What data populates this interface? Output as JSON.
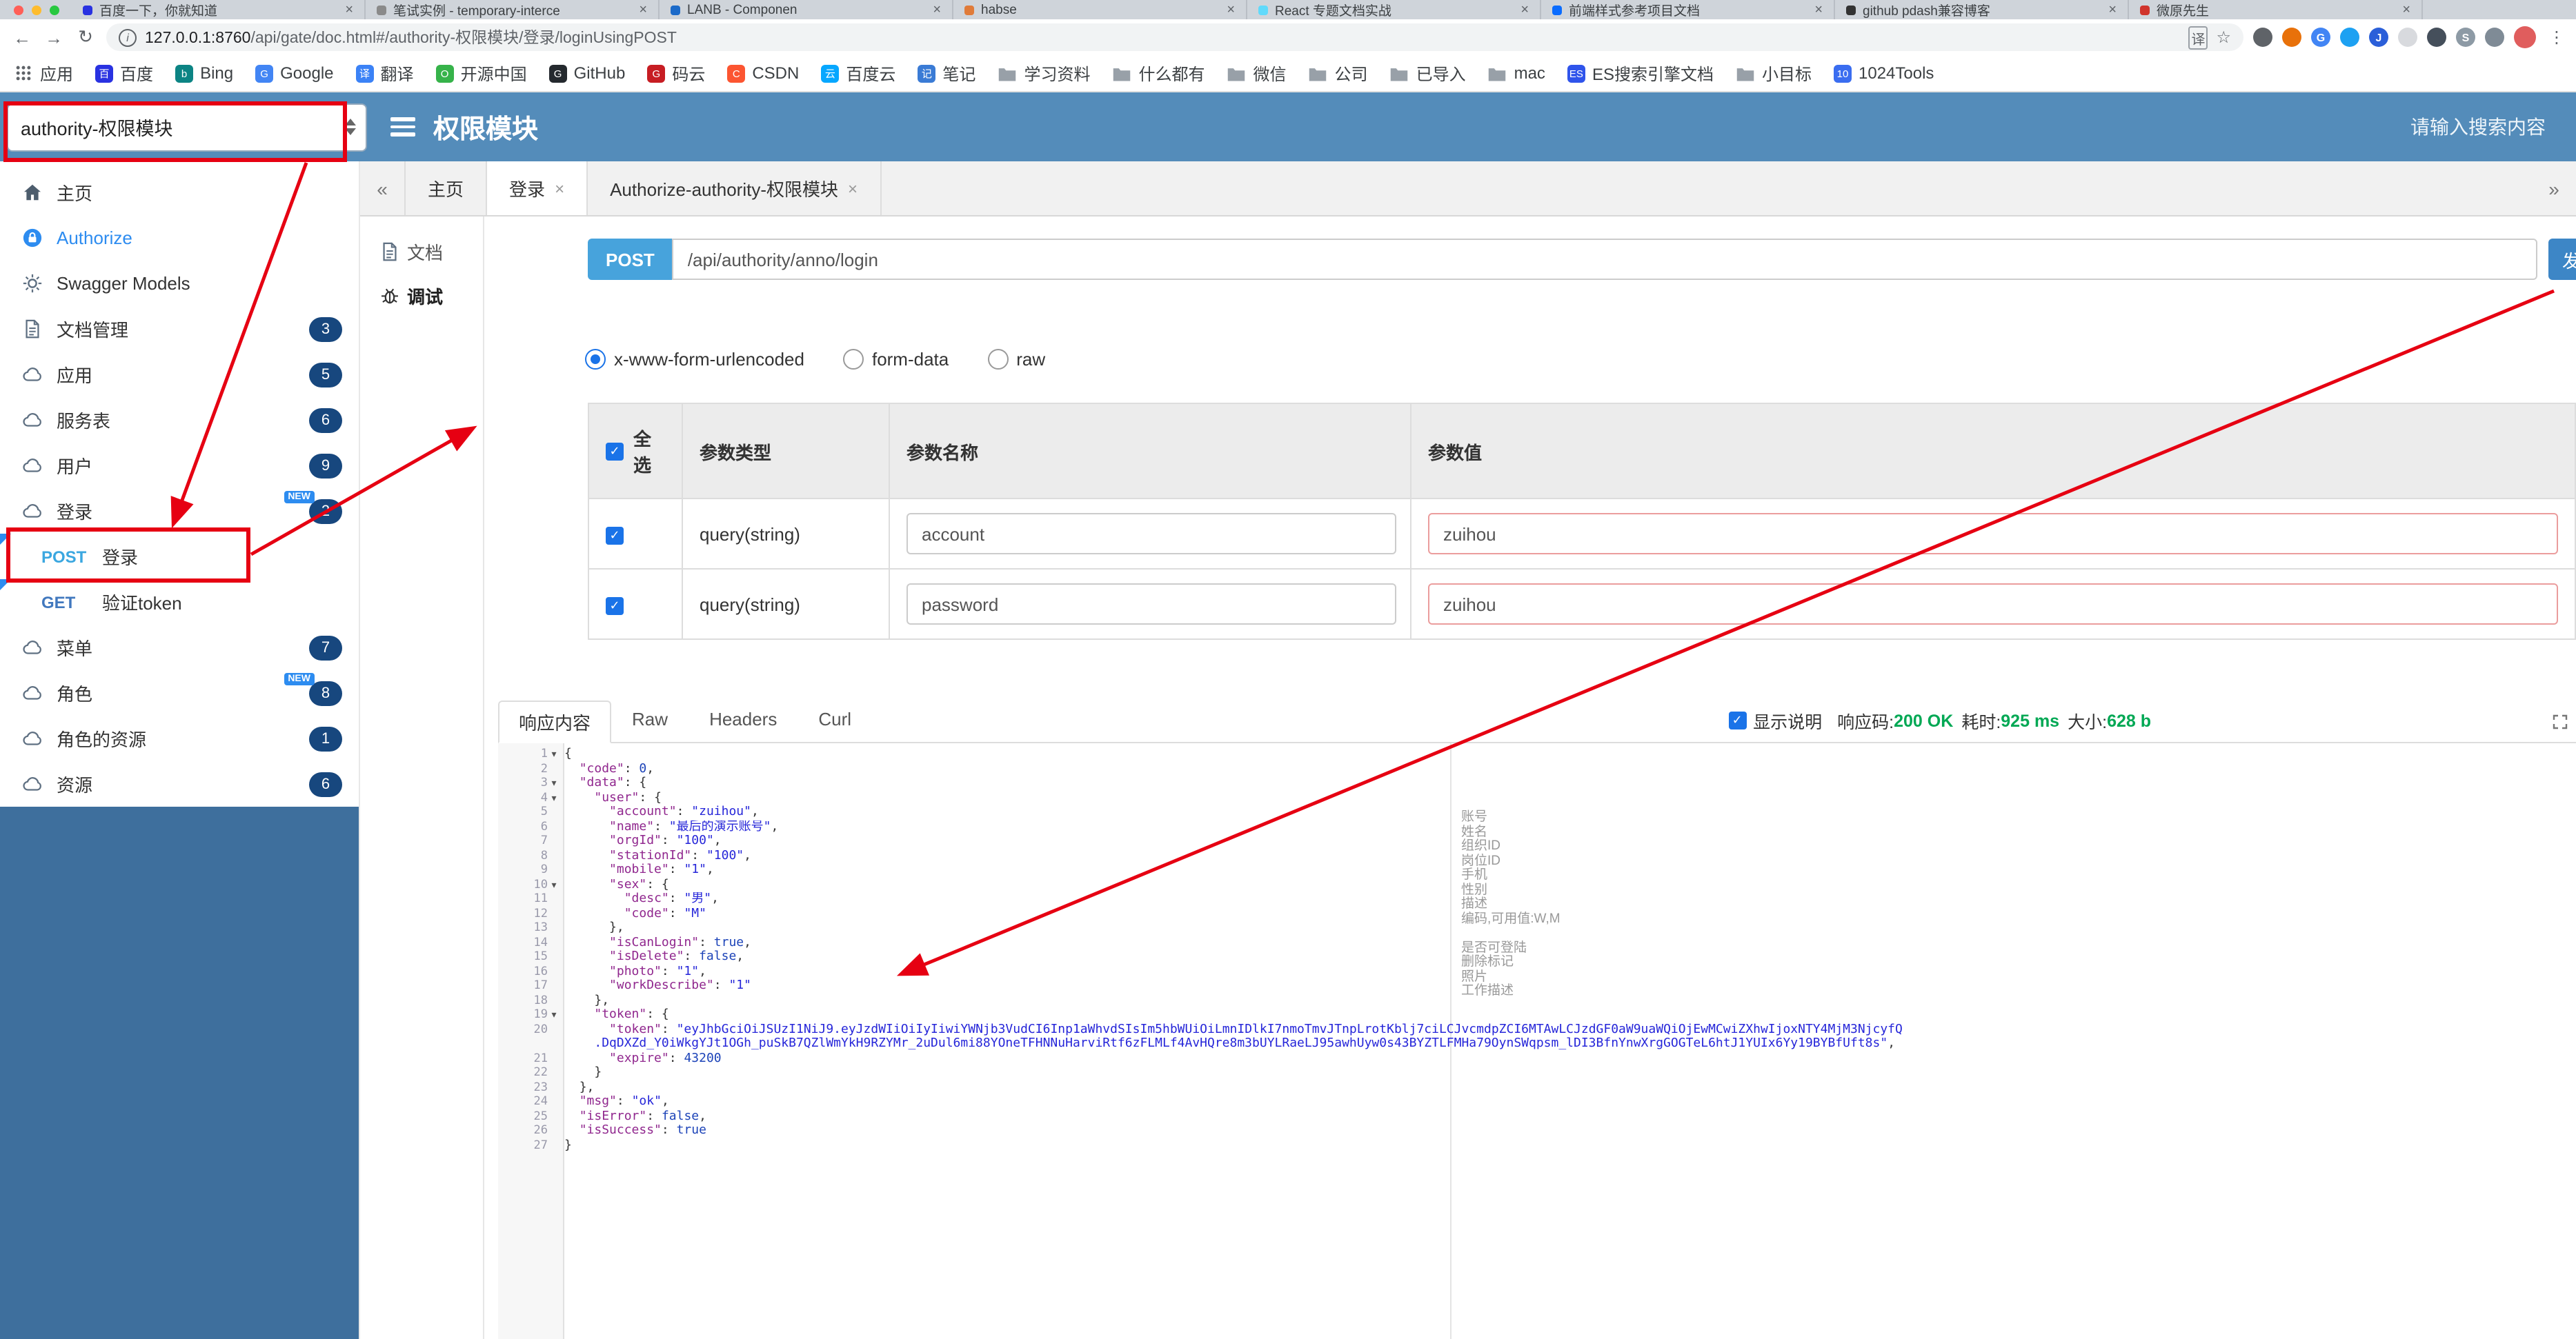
{
  "browser": {
    "tabs": [
      {
        "title": "百度一下，你就知道",
        "color": "#2932e1"
      },
      {
        "title": "笔试实例 - temporary-interce",
        "color": "#8a8a8a"
      },
      {
        "title": "LANB - Componen",
        "color": "#1b6ac9"
      },
      {
        "title": "habse",
        "color": "#e07b39"
      },
      {
        "title": "React 专题文档实战",
        "color": "#61dafb"
      },
      {
        "title": "前端样式参考项目文档",
        "color": "#0a6cff"
      },
      {
        "title": "github pdash兼容博客",
        "color": "#333333"
      },
      {
        "title": "微原先生",
        "color": "#d0342c"
      }
    ],
    "nav": {
      "back": "←",
      "forward": "→",
      "reload": "↻"
    },
    "url_host": "127.0.0.1:8760",
    "url_path": "/api/gate/doc.html#/authority-权限模块/登录/loginUsingPOST",
    "omnibox": {
      "info_glyph": "i",
      "translate_glyph": "译",
      "star_glyph": "☆"
    },
    "extensions": [
      {
        "name": "capture-extension-icon",
        "color": "#5f6368",
        "glyph": ""
      },
      {
        "name": "orange-extension-icon",
        "color": "#e8710a",
        "glyph": ""
      },
      {
        "name": "google-extension-icon",
        "color": "#4285f4",
        "glyph": "G"
      },
      {
        "name": "bird-extension-icon",
        "color": "#1da1f2",
        "glyph": ""
      },
      {
        "name": "json-viewer-extension-icon",
        "color": "#2b5fd9",
        "glyph": "J"
      },
      {
        "name": "circle-extension-icon",
        "color": "#d8dade",
        "glyph": ""
      },
      {
        "name": "shield-extension-icon",
        "color": "#454f5b",
        "glyph": ""
      },
      {
        "name": "site-extension-icon",
        "color": "#8d9aa5",
        "glyph": "S"
      },
      {
        "name": "puzzle-extension-icon",
        "color": "#7f8b96",
        "glyph": ""
      }
    ],
    "avatar_color": "#e05d5d",
    "menu_glyph": "⋮",
    "bookmarks": [
      {
        "label": "应用",
        "icon": "apps-grid-icon"
      },
      {
        "label": "百度",
        "icon": "site-icon",
        "color": "#2932e1",
        "letter": "百"
      },
      {
        "label": "Bing",
        "icon": "site-icon",
        "color": "#0c8484",
        "letter": "b"
      },
      {
        "label": "Google",
        "icon": "site-icon",
        "color": "#4285f4",
        "letter": "G"
      },
      {
        "label": "翻译",
        "icon": "site-icon",
        "color": "#3b82f6",
        "letter": "译"
      },
      {
        "label": "开源中国",
        "icon": "site-icon",
        "color": "#36b34a",
        "letter": "O"
      },
      {
        "label": "GitHub",
        "icon": "site-icon",
        "color": "#24292e",
        "letter": "G"
      },
      {
        "label": "码云",
        "icon": "site-icon",
        "color": "#c71d23",
        "letter": "G"
      },
      {
        "label": "CSDN",
        "icon": "site-icon",
        "color": "#fc5531",
        "letter": "C"
      },
      {
        "label": "百度云",
        "icon": "site-icon",
        "color": "#06a7ff",
        "letter": "云"
      },
      {
        "label": "笔记",
        "icon": "site-icon",
        "color": "#3a7bd5",
        "letter": "记"
      },
      {
        "label": "学习资料",
        "icon": "folder-icon"
      },
      {
        "label": "什么都有",
        "icon": "folder-icon"
      },
      {
        "label": "微信",
        "icon": "folder-icon"
      },
      {
        "label": "公司",
        "icon": "folder-icon"
      },
      {
        "label": "已导入",
        "icon": "folder-icon"
      },
      {
        "label": "mac",
        "icon": "folder-icon"
      },
      {
        "label": "ES搜索引擎文档",
        "icon": "site-icon",
        "color": "#2f54eb",
        "letter": "ES"
      },
      {
        "label": "小目标",
        "icon": "folder-icon"
      },
      {
        "label": "1024Tools",
        "icon": "site-icon",
        "color": "#3a6df0",
        "letter": "10"
      }
    ]
  },
  "header": {
    "module_select": "authority-权限模块",
    "title": "权限模块",
    "search_placeholder": "请输入搜索内容"
  },
  "sidebar": {
    "items": [
      {
        "type": "link",
        "icon": "home-icon",
        "label": "主页"
      },
      {
        "type": "link",
        "icon": "authorize-icon",
        "label": "Authorize",
        "style": "authorize"
      },
      {
        "type": "link",
        "icon": "gear-icon",
        "label": "Swagger Models"
      },
      {
        "type": "link",
        "icon": "doc-icon",
        "label": "文档管理",
        "badge": "3"
      },
      {
        "type": "group",
        "icon": "cloud-icon",
        "label": "应用",
        "badge": "5"
      },
      {
        "type": "group",
        "icon": "cloud-icon",
        "label": "服务表",
        "badge": "6"
      },
      {
        "type": "group",
        "icon": "cloud-icon",
        "label": "用户",
        "badge": "9"
      },
      {
        "type": "group",
        "icon": "cloud-icon",
        "label": "登录",
        "badge": "2",
        "new": true
      },
      {
        "type": "api",
        "method": "POST",
        "label": "登录",
        "marker": true
      },
      {
        "type": "api",
        "method": "GET",
        "label": "验证token",
        "marker": true
      },
      {
        "type": "group",
        "icon": "cloud-icon",
        "label": "菜单",
        "badge": "7"
      },
      {
        "type": "group",
        "icon": "cloud-icon",
        "label": "角色",
        "badge": "8",
        "new": true
      },
      {
        "type": "group",
        "icon": "cloud-icon",
        "label": "角色的资源",
        "badge": "1"
      },
      {
        "type": "group",
        "icon": "cloud-icon",
        "label": "资源",
        "badge": "6"
      }
    ]
  },
  "page_tabs": {
    "scroll_left": "«",
    "scroll_right": "»",
    "items": [
      {
        "label": "主页",
        "closable": false,
        "active": false
      },
      {
        "label": "登录",
        "closable": true,
        "active": true
      },
      {
        "label": "Authorize-authority-权限模块",
        "closable": true,
        "active": false
      }
    ]
  },
  "doc_strip": [
    {
      "label": "文档",
      "icon": "doc-icon",
      "active": false
    },
    {
      "label": "调试",
      "icon": "bug-icon",
      "active": true
    }
  ],
  "request": {
    "method": "POST",
    "url": "/api/authority/anno/login",
    "send_label": "发送",
    "content_types": [
      {
        "label": "x-www-form-urlencoded",
        "selected": true
      },
      {
        "label": "form-data",
        "selected": false
      },
      {
        "label": "raw",
        "selected": false
      }
    ]
  },
  "params_table": {
    "select_all": "全选",
    "columns": [
      "参数类型",
      "参数名称",
      "参数值"
    ],
    "rows": [
      {
        "checked": true,
        "type": "query(string)",
        "name": "account",
        "value": "zuihou"
      },
      {
        "checked": true,
        "type": "query(string)",
        "name": "password",
        "value": "zuihou"
      }
    ]
  },
  "response": {
    "tabs": [
      {
        "label": "响应内容",
        "active": true
      },
      {
        "label": "Raw",
        "active": false
      },
      {
        "label": "Headers",
        "active": false
      },
      {
        "label": "Curl",
        "active": false
      }
    ],
    "show_desc": "显示说明",
    "meta": [
      {
        "label": "响应码:",
        "value": "200 OK",
        "color": "#00a854"
      },
      {
        "label": "耗时:",
        "value": "925 ms",
        "color": "#00a854"
      },
      {
        "label": "大小:",
        "value": "628 b",
        "color": "#00a854"
      }
    ]
  },
  "editor": {
    "lines": [
      {
        "n": 1,
        "ind": 0,
        "fold": true,
        "t": [
          [
            "p",
            "{"
          ]
        ]
      },
      {
        "n": 2,
        "ind": 2,
        "t": [
          [
            "k",
            "\"code\""
          ],
          [
            "p",
            ": "
          ],
          [
            "n",
            "0"
          ],
          [
            "p",
            ","
          ]
        ]
      },
      {
        "n": 3,
        "ind": 2,
        "fold": true,
        "t": [
          [
            "k",
            "\"data\""
          ],
          [
            "p",
            ": {"
          ]
        ]
      },
      {
        "n": 4,
        "ind": 4,
        "fold": true,
        "t": [
          [
            "k",
            "\"user\""
          ],
          [
            "p",
            ": {"
          ]
        ]
      },
      {
        "n": 5,
        "ind": 6,
        "t": [
          [
            "k",
            "\"account\""
          ],
          [
            "p",
            ": "
          ],
          [
            "s",
            "\"zuihou\""
          ],
          [
            "p",
            ","
          ]
        ]
      },
      {
        "n": 6,
        "ind": 6,
        "t": [
          [
            "k",
            "\"name\""
          ],
          [
            "p",
            ": "
          ],
          [
            "s",
            "\"最后的演示账号\""
          ],
          [
            "p",
            ","
          ]
        ]
      },
      {
        "n": 7,
        "ind": 6,
        "t": [
          [
            "k",
            "\"orgId\""
          ],
          [
            "p",
            ": "
          ],
          [
            "s",
            "\"100\""
          ],
          [
            "p",
            ","
          ]
        ]
      },
      {
        "n": 8,
        "ind": 6,
        "t": [
          [
            "k",
            "\"stationId\""
          ],
          [
            "p",
            ": "
          ],
          [
            "s",
            "\"100\""
          ],
          [
            "p",
            ","
          ]
        ]
      },
      {
        "n": 9,
        "ind": 6,
        "t": [
          [
            "k",
            "\"mobile\""
          ],
          [
            "p",
            ": "
          ],
          [
            "s",
            "\"1\""
          ],
          [
            "p",
            ","
          ]
        ]
      },
      {
        "n": 10,
        "ind": 6,
        "fold": true,
        "t": [
          [
            "k",
            "\"sex\""
          ],
          [
            "p",
            ": {"
          ]
        ]
      },
      {
        "n": 11,
        "ind": 8,
        "t": [
          [
            "k",
            "\"desc\""
          ],
          [
            "p",
            ": "
          ],
          [
            "s",
            "\"男\""
          ],
          [
            "p",
            ","
          ]
        ]
      },
      {
        "n": 12,
        "ind": 8,
        "t": [
          [
            "k",
            "\"code\""
          ],
          [
            "p",
            ": "
          ],
          [
            "s",
            "\"M\""
          ]
        ]
      },
      {
        "n": 13,
        "ind": 6,
        "t": [
          [
            "p",
            "},"
          ]
        ]
      },
      {
        "n": 14,
        "ind": 6,
        "t": [
          [
            "k",
            "\"isCanLogin\""
          ],
          [
            "p",
            ": "
          ],
          [
            "a",
            "true"
          ],
          [
            "p",
            ","
          ]
        ]
      },
      {
        "n": 15,
        "ind": 6,
        "t": [
          [
            "k",
            "\"isDelete\""
          ],
          [
            "p",
            ": "
          ],
          [
            "a",
            "false"
          ],
          [
            "p",
            ","
          ]
        ]
      },
      {
        "n": 16,
        "ind": 6,
        "t": [
          [
            "k",
            "\"photo\""
          ],
          [
            "p",
            ": "
          ],
          [
            "s",
            "\"1\""
          ],
          [
            "p",
            ","
          ]
        ]
      },
      {
        "n": 17,
        "ind": 6,
        "t": [
          [
            "k",
            "\"workDescribe\""
          ],
          [
            "p",
            ": "
          ],
          [
            "s",
            "\"1\""
          ]
        ]
      },
      {
        "n": 18,
        "ind": 4,
        "t": [
          [
            "p",
            "},"
          ]
        ]
      },
      {
        "n": 19,
        "ind": 4,
        "fold": true,
        "t": [
          [
            "k",
            "\"token\""
          ],
          [
            "p",
            ": {"
          ]
        ]
      },
      {
        "n": 20,
        "ind": 6,
        "t": [
          [
            "k",
            "\"token\""
          ],
          [
            "p",
            ": "
          ],
          [
            "s",
            "\"eyJhbGciOiJSUzI1NiJ9.eyJzdWIiOiIyIiwiYWNjb3VudCI6Inp1aWhvdSIsIm5hbWUiOiLmnIDlkI7nmoTmvJTnpLrotKblj7ciLCJvcmdpZCI6MTAwLCJzdGF0aW9uaWQiOjEwMCwiZXhwIjoxNTY4MjM3NjcyfQ"
          ]
        ]
      },
      {
        "n": "",
        "ind": 4,
        "t": [
          [
            "s",
            ".DqDXZd_Y0iWkgYJt1OGh_puSkB7QZlWmYkH9RZYMr_2uDul6mi88YOneTFHNNuHarviRtf6zFLMLf4AvHQre8m3bUYLRaeLJ95awhUyw0s43BYZTLFMHa79OynSWqpsm_lDI3BfnYnwXrgGOGTeL6htJ1YUIx6Yy19BYBfUft8s\""
          ],
          [
            "p",
            ","
          ]
        ]
      },
      {
        "n": 21,
        "ind": 6,
        "t": [
          [
            "k",
            "\"expire\""
          ],
          [
            "p",
            ": "
          ],
          [
            "n",
            "43200"
          ]
        ]
      },
      {
        "n": 22,
        "ind": 4,
        "t": [
          [
            "p",
            "}"
          ]
        ]
      },
      {
        "n": 23,
        "ind": 2,
        "t": [
          [
            "p",
            "},"
          ]
        ]
      },
      {
        "n": 24,
        "ind": 2,
        "t": [
          [
            "k",
            "\"msg\""
          ],
          [
            "p",
            ": "
          ],
          [
            "s",
            "\"ok\""
          ],
          [
            "p",
            ","
          ]
        ]
      },
      {
        "n": 25,
        "ind": 2,
        "t": [
          [
            "k",
            "\"isError\""
          ],
          [
            "p",
            ": "
          ],
          [
            "a",
            "false"
          ],
          [
            "p",
            ","
          ]
        ]
      },
      {
        "n": 26,
        "ind": 2,
        "t": [
          [
            "k",
            "\"isSuccess\""
          ],
          [
            "p",
            ": "
          ],
          [
            "a",
            "true"
          ]
        ]
      },
      {
        "n": 27,
        "ind": 0,
        "t": [
          [
            "p",
            "}"
          ]
        ]
      }
    ],
    "annotations": [
      {
        "line": 5,
        "text": "账号"
      },
      {
        "line": 6,
        "text": "姓名"
      },
      {
        "line": 7,
        "text": "组织ID"
      },
      {
        "line": 8,
        "text": "岗位ID"
      },
      {
        "line": 9,
        "text": "手机"
      },
      {
        "line": 10,
        "text": "性别"
      },
      {
        "line": 11,
        "text": "描述"
      },
      {
        "line": 12,
        "text": "编码,可用值:W,M"
      },
      {
        "line": 14,
        "text": "是否可登陆"
      },
      {
        "line": 15,
        "text": "删除标记"
      },
      {
        "line": 16,
        "text": "照片"
      },
      {
        "line": 17,
        "text": "工作描述"
      }
    ]
  }
}
